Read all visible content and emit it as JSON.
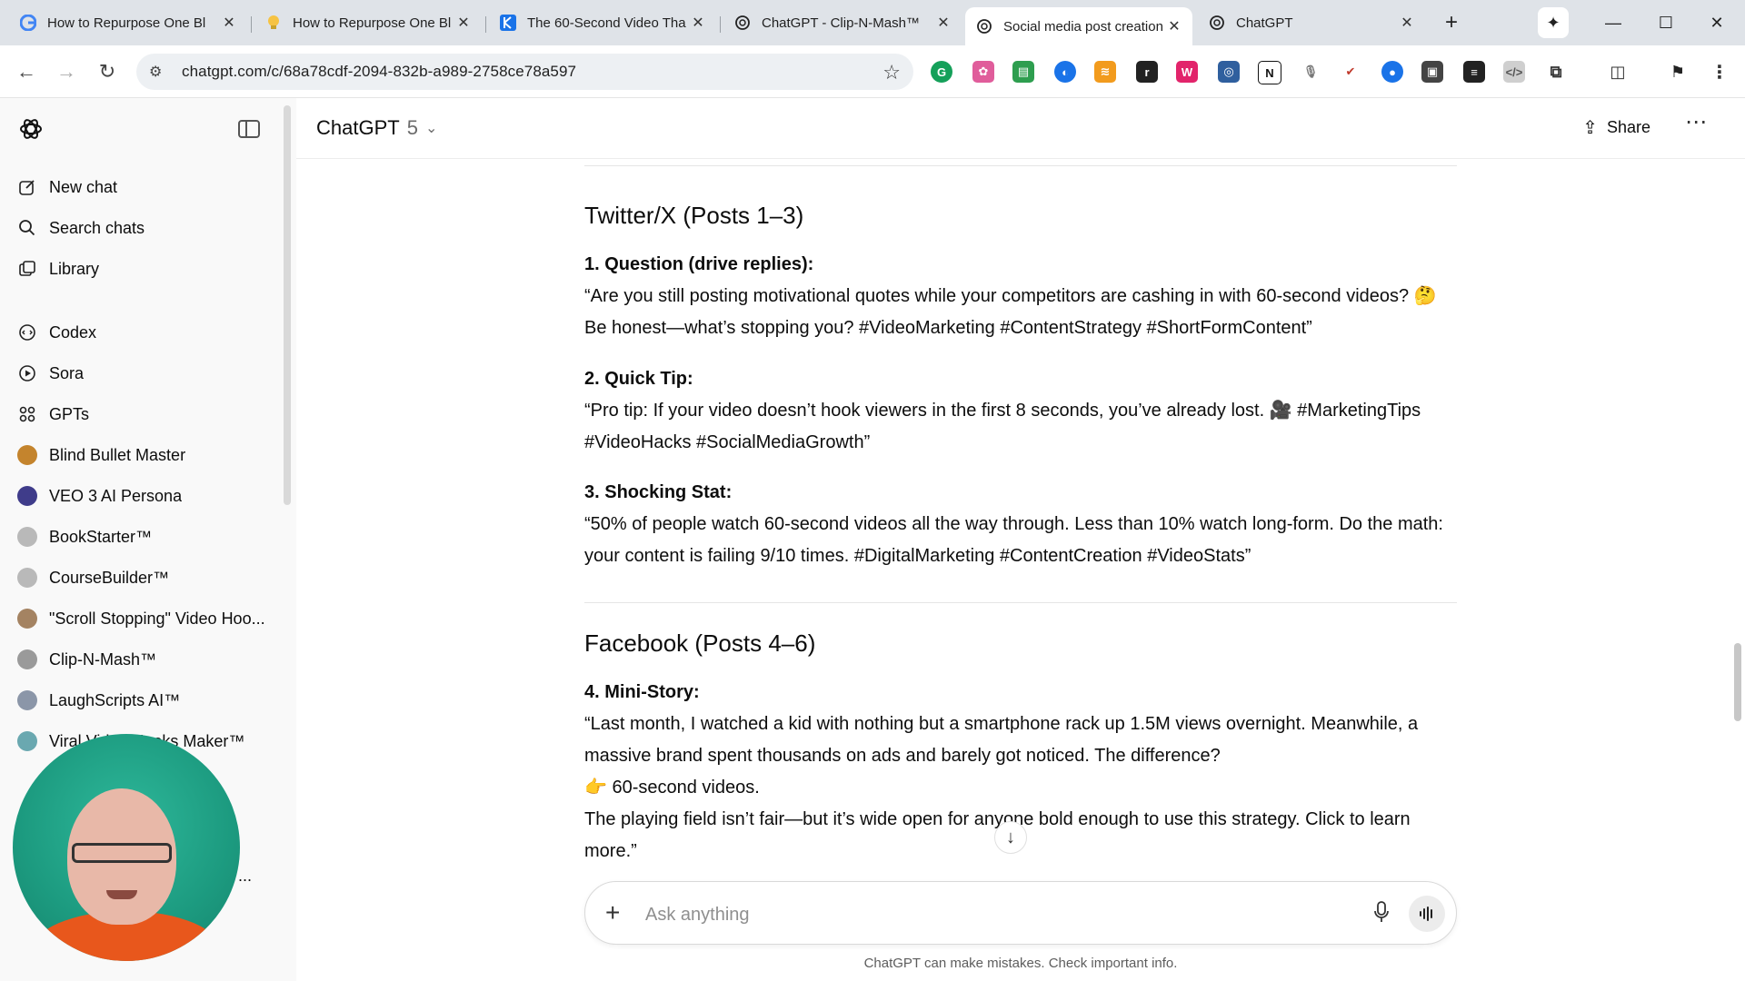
{
  "browser": {
    "tabs": [
      {
        "title": "How to Repurpose One Bl",
        "icon": "google-icon"
      },
      {
        "title": "How to Repurpose One Bl",
        "icon": "lightbulb-icon"
      },
      {
        "title": "The 60-Second Video Tha",
        "icon": "blue-k-icon"
      },
      {
        "title": "ChatGPT - Clip-N-Mash™",
        "icon": "openai-icon"
      },
      {
        "title": "Social media post creation",
        "icon": "openai-icon",
        "active": true
      },
      {
        "title": "ChatGPT",
        "icon": "openai-icon"
      }
    ],
    "url": "chatgpt.com/c/68a78cdf-2094-832b-a989-2758ce78a597",
    "window_controls": [
      "minimize",
      "maximize",
      "close"
    ]
  },
  "sidebar": {
    "items": [
      {
        "label": "New chat",
        "icon": "pencil-square-icon"
      },
      {
        "label": "Search chats",
        "icon": "search-icon"
      },
      {
        "label": "Library",
        "icon": "library-icon"
      },
      {
        "label": "Codex",
        "icon": "codex-icon"
      },
      {
        "label": "Sora",
        "icon": "play-circle-icon"
      },
      {
        "label": "GPTs",
        "icon": "grid-icon"
      },
      {
        "label": "Blind Bullet Master",
        "icon": "gpt-avatar",
        "color": "#c4842d"
      },
      {
        "label": "VEO 3 AI Persona",
        "icon": "gpt-avatar",
        "color": "#3f3c8a"
      },
      {
        "label": "BookStarter™",
        "icon": "gpt-avatar",
        "color": "#b9b9b9"
      },
      {
        "label": "CourseBuilder™",
        "icon": "gpt-avatar",
        "color": "#b9b9b9"
      },
      {
        "label": "\"Scroll Stopping\" Video Hoo...",
        "icon": "gpt-avatar",
        "color": "#a48362"
      },
      {
        "label": "Clip-N-Mash™",
        "icon": "gpt-avatar",
        "color": "#9a9a9a"
      },
      {
        "label": "LaughScripts AI™",
        "icon": "gpt-avatar",
        "color": "#8b96a8"
      },
      {
        "label": "Viral Video Hooks Maker™",
        "icon": "gpt-avatar",
        "color": "#6aa8b0"
      }
    ],
    "more_indicator": "..."
  },
  "header": {
    "model_name": "ChatGPT",
    "model_version": "5",
    "share_label": "Share"
  },
  "sections": [
    {
      "heading": "Twitter/X (Posts 1–3)",
      "posts": [
        {
          "title": "1. Question (drive replies):",
          "lines": [
            "“Are you still posting motivational quotes while your competitors are cashing in with 60-second videos? 🤔",
            "Be honest—what’s stopping you? #VideoMarketing #ContentStrategy #ShortFormContent”"
          ]
        },
        {
          "title": "2. Quick Tip:",
          "lines": [
            "“Pro tip: If your video doesn’t hook viewers in the first 8 seconds, you’ve already lost. 🎥 #MarketingTips",
            "#VideoHacks #SocialMediaGrowth”"
          ]
        },
        {
          "title": "3. Shocking Stat:",
          "lines": [
            "“50% of people watch 60-second videos all the way through. Less than 10% watch long-form. Do the math:",
            "your content is failing 9/10 times. #DigitalMarketing #ContentCreation #VideoStats”"
          ]
        }
      ]
    },
    {
      "heading": "Facebook (Posts 4–6)",
      "posts": [
        {
          "title": "4. Mini-Story:",
          "lines": [
            "“Last month, I watched a kid with nothing but a smartphone rack up 1.5M views overnight. Meanwhile, a",
            "massive brand spent thousands on ads and barely got noticed. The difference?",
            "👉 60-second videos.",
            "The playing field isn’t fair—but it’s wide open for anyone bold enough to use this strategy. Click to learn",
            "more.”"
          ]
        }
      ]
    }
  ],
  "composer": {
    "placeholder": "Ask anything"
  },
  "disclaimer": "ChatGPT can make mistakes. Check important info."
}
